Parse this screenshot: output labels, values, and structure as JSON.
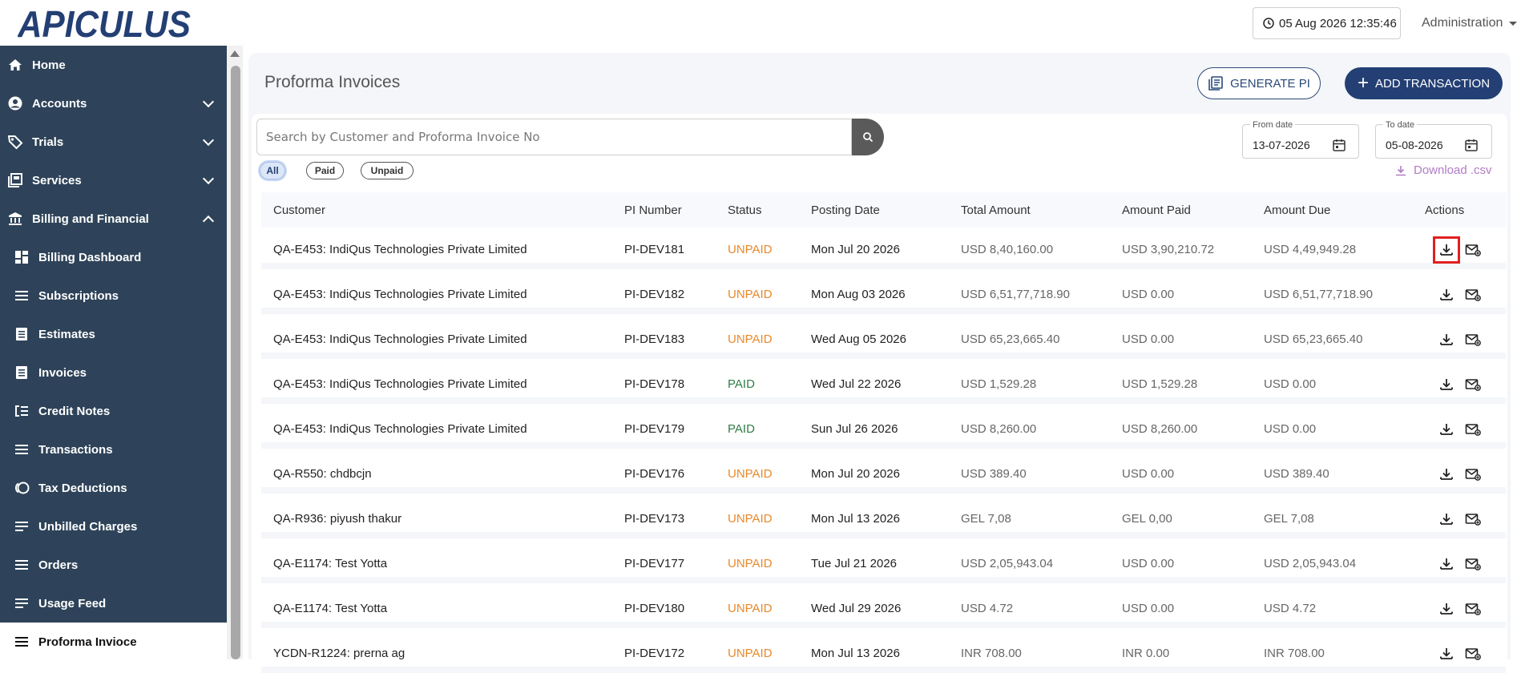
{
  "header": {
    "logo_text": "APICULUS",
    "datetime": "05 Aug 2026 12:35:46",
    "user_menu": "Administration"
  },
  "sidebar": {
    "items": [
      {
        "label": "Home",
        "icon": "home-icon",
        "level": "top",
        "chevron": "none"
      },
      {
        "label": "Accounts",
        "icon": "account-icon",
        "level": "top",
        "chevron": "down"
      },
      {
        "label": "Trials",
        "icon": "tag-icon",
        "level": "top",
        "chevron": "down"
      },
      {
        "label": "Services",
        "icon": "services-icon",
        "level": "top",
        "chevron": "down"
      },
      {
        "label": "Billing and Financial",
        "icon": "bank-icon",
        "level": "top",
        "chevron": "up"
      },
      {
        "label": "Billing Dashboard",
        "icon": "dashboard-icon",
        "level": "sub",
        "chevron": "none"
      },
      {
        "label": "Subscriptions",
        "icon": "list-icon",
        "level": "sub",
        "chevron": "none"
      },
      {
        "label": "Estimates",
        "icon": "document-icon",
        "level": "sub",
        "chevron": "none"
      },
      {
        "label": "Invoices",
        "icon": "document-icon",
        "level": "sub",
        "chevron": "none"
      },
      {
        "label": "Credit Notes",
        "icon": "credit-notes-icon",
        "level": "sub",
        "chevron": "none"
      },
      {
        "label": "Transactions",
        "icon": "list-icon",
        "level": "sub",
        "chevron": "none"
      },
      {
        "label": "Tax Deductions",
        "icon": "tax-icon",
        "level": "sub",
        "chevron": "none"
      },
      {
        "label": "Unbilled Charges",
        "icon": "notes-icon",
        "level": "sub",
        "chevron": "none"
      },
      {
        "label": "Orders",
        "icon": "list-icon",
        "level": "sub",
        "chevron": "none"
      },
      {
        "label": "Usage Feed",
        "icon": "notes-icon",
        "level": "sub",
        "chevron": "none"
      },
      {
        "label": "Proforma Invioce",
        "icon": "list-icon",
        "level": "sub",
        "chevron": "none",
        "active": true
      }
    ]
  },
  "main": {
    "title": "Proforma Invoices",
    "generate_pi_label": "GENERATE PI",
    "add_transaction_label": "ADD TRANSACTION",
    "search": {
      "placeholder": "Search by Customer and Proforma Invoice No",
      "value": ""
    },
    "filters": [
      {
        "label": "All",
        "selected": true
      },
      {
        "label": "Paid",
        "selected": false
      },
      {
        "label": "Unpaid",
        "selected": false
      }
    ],
    "from_date": {
      "label": "From date",
      "value": "13-07-2026"
    },
    "to_date": {
      "label": "To date",
      "value": "05-08-2026"
    },
    "download_csv": "Download .csv"
  },
  "table": {
    "columns": [
      "Customer",
      "PI Number",
      "Status",
      "Posting Date",
      "Total Amount",
      "Amount Paid",
      "Amount Due",
      "Actions"
    ],
    "rows": [
      {
        "customer": "QA-E453: IndiQus Technologies Private Limited",
        "pi": "PI-DEV181",
        "status": "UNPAID",
        "date": "Mon Jul 20 2026",
        "total": "USD 8,40,160.00",
        "paid": "USD 3,90,210.72",
        "due": "USD 4,49,949.28"
      },
      {
        "customer": "QA-E453: IndiQus Technologies Private Limited",
        "pi": "PI-DEV182",
        "status": "UNPAID",
        "date": "Mon Aug 03 2026",
        "total": "USD 6,51,77,718.90",
        "paid": "USD 0.00",
        "due": "USD 6,51,77,718.90"
      },
      {
        "customer": "QA-E453: IndiQus Technologies Private Limited",
        "pi": "PI-DEV183",
        "status": "UNPAID",
        "date": "Wed Aug 05 2026",
        "total": "USD 65,23,665.40",
        "paid": "USD 0.00",
        "due": "USD 65,23,665.40"
      },
      {
        "customer": "QA-E453: IndiQus Technologies Private Limited",
        "pi": "PI-DEV178",
        "status": "PAID",
        "date": "Wed Jul 22 2026",
        "total": "USD 1,529.28",
        "paid": "USD 1,529.28",
        "due": "USD 0.00"
      },
      {
        "customer": "QA-E453: IndiQus Technologies Private Limited",
        "pi": "PI-DEV179",
        "status": "PAID",
        "date": "Sun Jul 26 2026",
        "total": "USD 8,260.00",
        "paid": "USD 8,260.00",
        "due": "USD 0.00"
      },
      {
        "customer": "QA-R550: chdbcjn",
        "pi": "PI-DEV176",
        "status": "UNPAID",
        "date": "Mon Jul 20 2026",
        "total": "USD 389.40",
        "paid": "USD 0.00",
        "due": "USD 389.40"
      },
      {
        "customer": "QA-R936: piyush thakur",
        "pi": "PI-DEV173",
        "status": "UNPAID",
        "date": "Mon Jul 13 2026",
        "total": "GEL 7,08",
        "paid": "GEL 0,00",
        "due": "GEL 7,08"
      },
      {
        "customer": "QA-E1174: Test Yotta",
        "pi": "PI-DEV177",
        "status": "UNPAID",
        "date": "Tue Jul 21 2026",
        "total": "USD 2,05,943.04",
        "paid": "USD 0.00",
        "due": "USD 2,05,943.04"
      },
      {
        "customer": "QA-E1174: Test Yotta",
        "pi": "PI-DEV180",
        "status": "UNPAID",
        "date": "Wed Jul 29 2026",
        "total": "USD 4.72",
        "paid": "USD 0.00",
        "due": "USD 4.72"
      },
      {
        "customer": "YCDN-R1224: prerna ag",
        "pi": "PI-DEV172",
        "status": "UNPAID",
        "date": "Mon Jul 13 2026",
        "total": "INR 708.00",
        "paid": "INR 0.00",
        "due": "INR 708.00"
      }
    ]
  },
  "colors": {
    "sidebar_bg": "#2e4359",
    "primary": "#233f74",
    "unpaid": "#e8892b",
    "paid": "#2e7d46",
    "csv_link": "#b07cc6",
    "highlight": "#e02020"
  }
}
